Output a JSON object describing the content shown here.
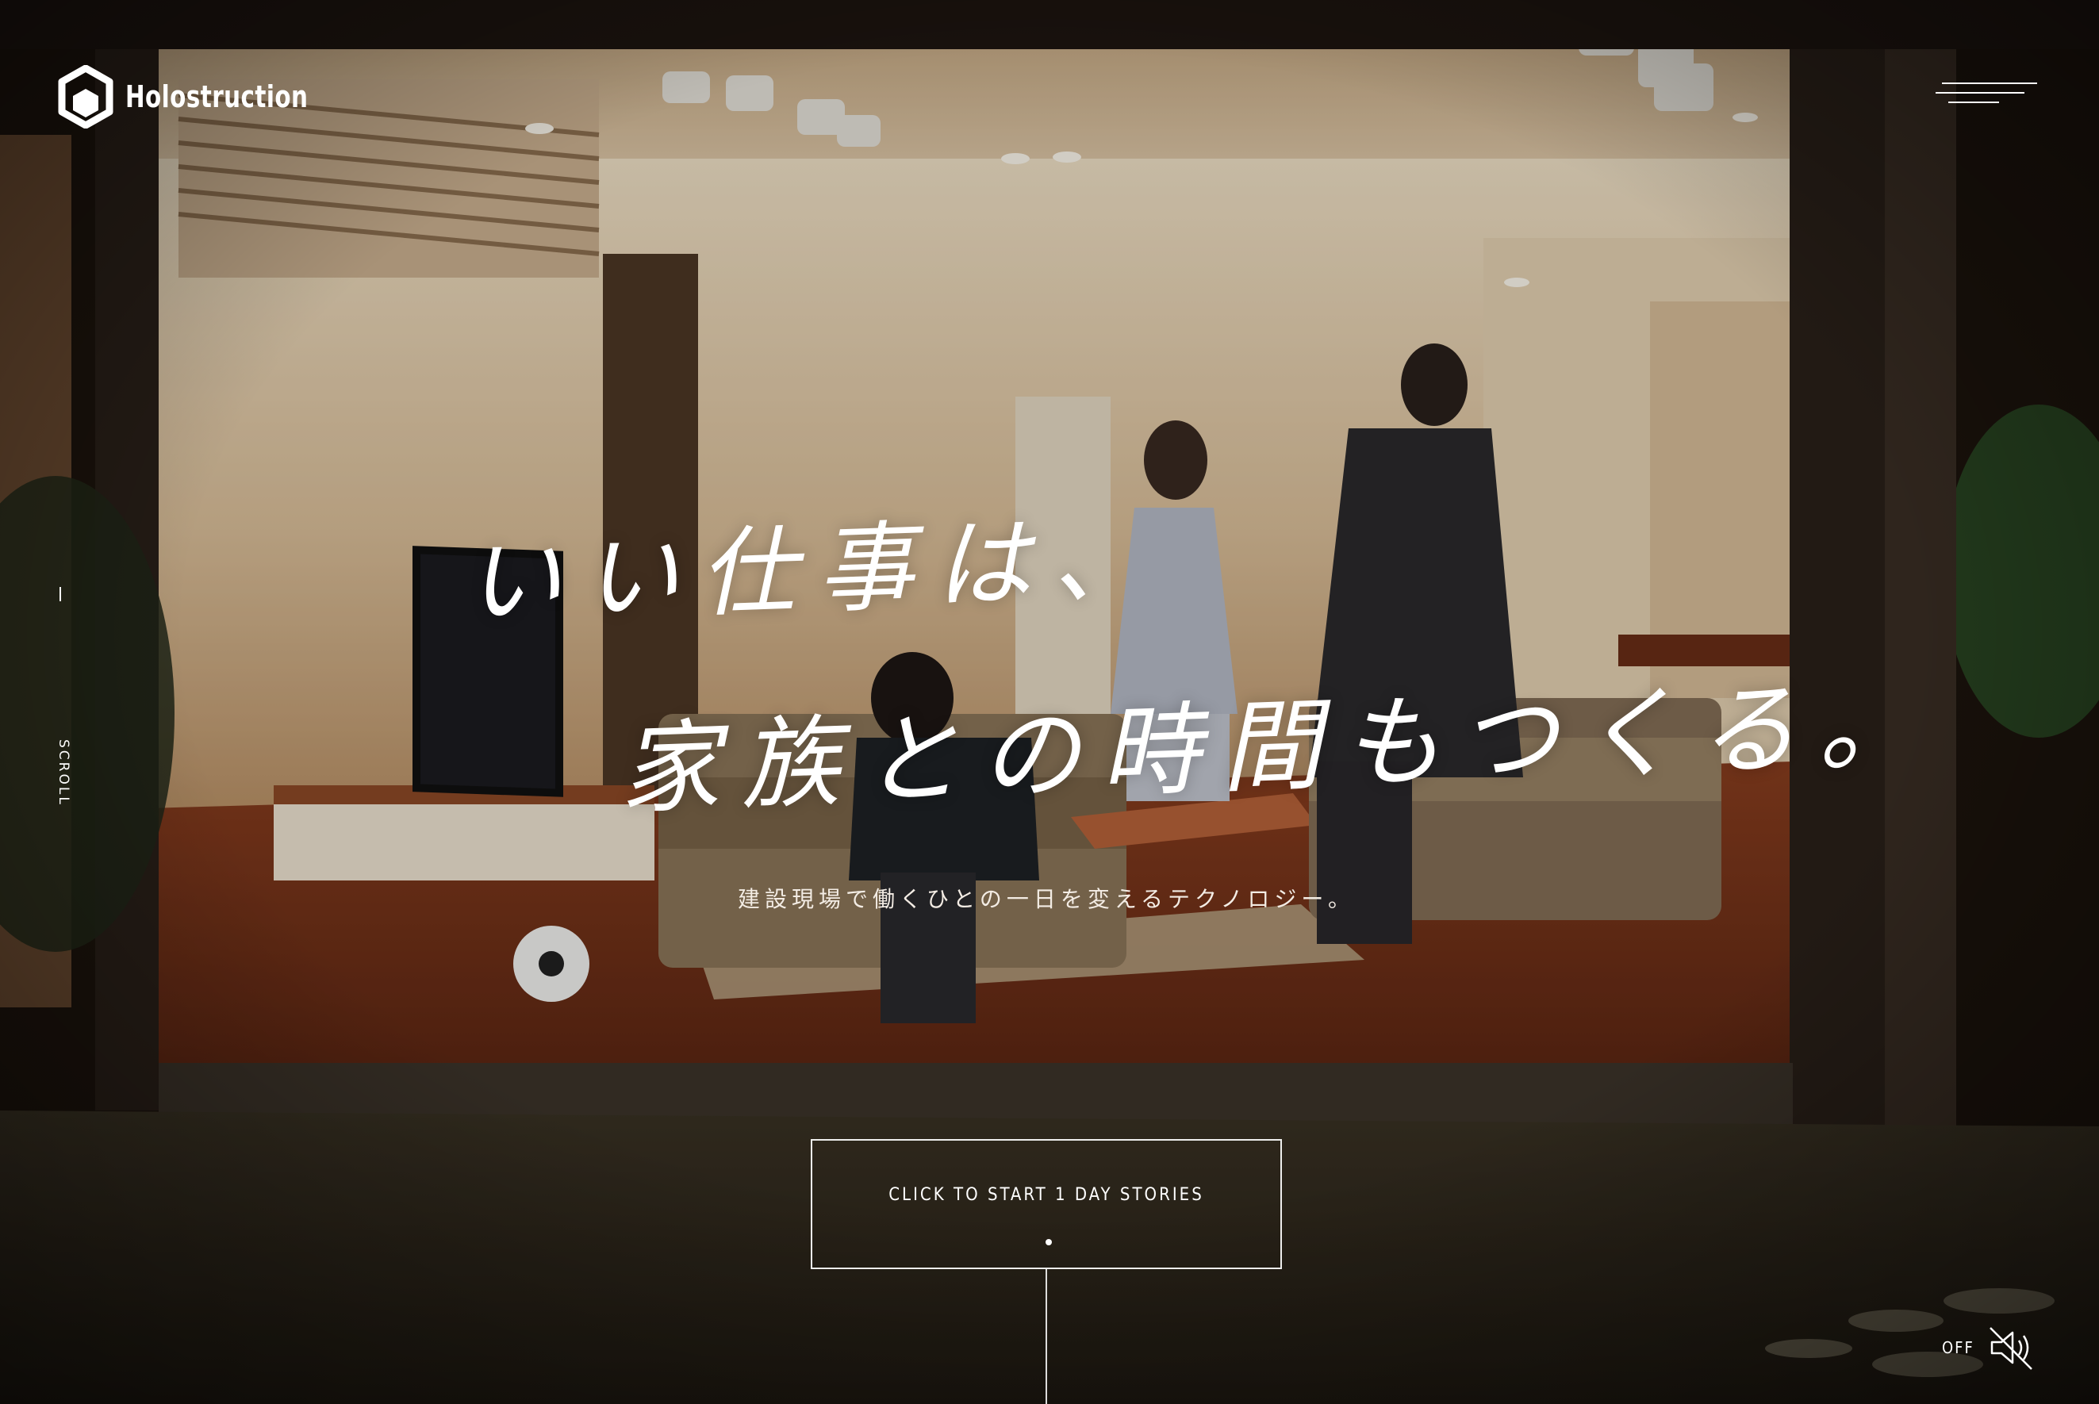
{
  "header": {
    "logo_text": "Holostruction",
    "logo_icon": "holostruction-cube-logo",
    "menu_icon": "hamburger-menu-icon"
  },
  "hero": {
    "headline_line1": "いい仕事は、",
    "headline_line2": "家族との時間もつくる。",
    "subtitle": "建設現場で働くひとの一日を変えるテクノロジー。"
  },
  "scroll": {
    "label": "SCROLL"
  },
  "cta": {
    "label": "CLICK TO START 1 DAY STORIES"
  },
  "sound": {
    "label": "OFF",
    "icon": "speaker-muted-icon"
  },
  "colors": {
    "text": "#ffffff",
    "floor": "#6e2f19",
    "wall": "#e6cfae",
    "frame": "#2a2019"
  }
}
